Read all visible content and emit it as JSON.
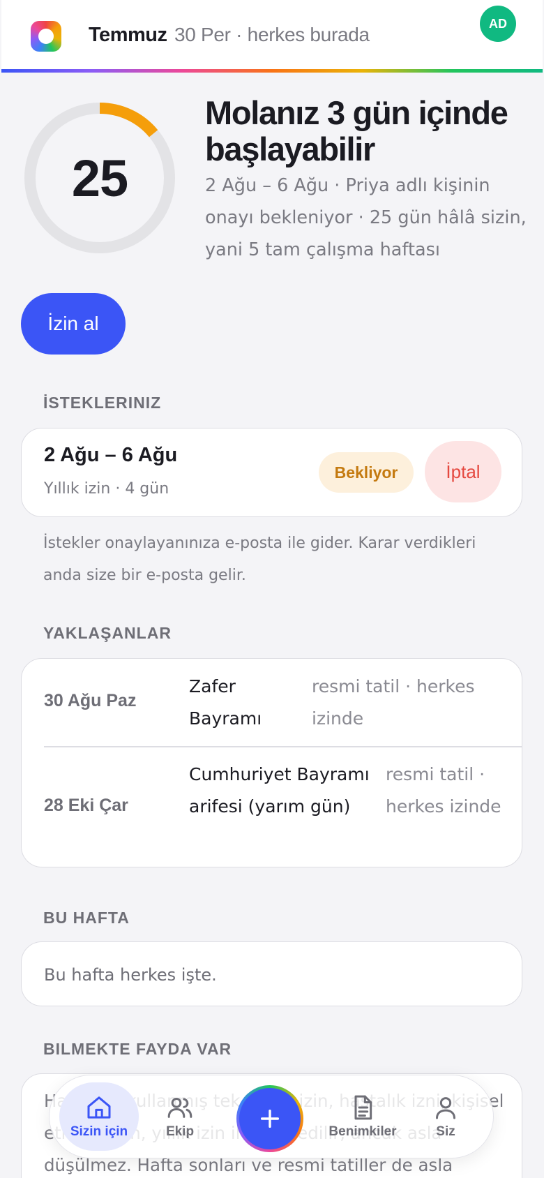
{
  "header": {
    "title": "Temmuz",
    "subtitle": "30 Per · herkes burada",
    "avatar_initials": "AD"
  },
  "hero": {
    "days_remaining": "25",
    "ring_fraction_used": 0.14,
    "ring_color": "#f59e0b",
    "title": "Molanız 3 gün içinde başlayabilir",
    "description": "2 Ağu – 6 Ağu · Priya adlı kişinin onayı bekleniyor · 25 gün hâlâ sizin, yani 5 tam çalışma haftası",
    "cta_label": "İzin al"
  },
  "requests": {
    "label": "İSTEKLERINIZ",
    "items": [
      {
        "dates": "2 Ağu – 6 Ağu",
        "meta": "Yıllık izin · 4 gün",
        "status": "Bekliyor",
        "cancel_label": "İptal"
      }
    ],
    "note": "İstekler onaylayanınıza e-posta ile gider. Karar verdikleri anda size bir e-posta gelir."
  },
  "upcoming": {
    "label": "YAKLAŞANLAR",
    "rows": [
      {
        "date": "30 Ağu Paz",
        "name": "Zafer Bayramı",
        "desc": "resmi tatil · herkes izinde"
      },
      {
        "date": "28 Eki Çar",
        "name": "Cumhuriyet Bayramı arifesi (yarım gün)",
        "desc": "resmi tatil · herkes izinde"
      }
    ]
  },
  "this_week": {
    "label": "BU HAFTA",
    "text": "Bu hafta herkes işte."
  },
  "tips": {
    "label": "BILMEKTE FAYDA VAR",
    "text": "Hakkınızı kullanmış tek kişilik izin, hastalık izni, kişisel etkinlik izin, yıllık izin ile kaydedilir, ancak asla düşülmez. Hafta sonları ve resmi tatiller de asla düşülmez."
  },
  "nav": {
    "items": [
      {
        "label": "Sizin için",
        "icon": "home-icon"
      },
      {
        "label": "Ekip",
        "icon": "users-icon"
      },
      {
        "label": "Benimkiler",
        "icon": "document-icon"
      },
      {
        "label": "Siz",
        "icon": "user-icon"
      }
    ],
    "fab_icon": "plus-icon"
  },
  "colors": {
    "primary": "#3b55f6",
    "pending_bg": "#fdf0dc",
    "pending_text": "#c47a10",
    "cancel_bg": "#fde4e4",
    "cancel_text": "#e5483f",
    "avatar_bg": "#10b981"
  }
}
